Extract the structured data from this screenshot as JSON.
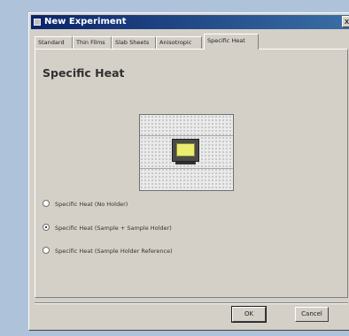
{
  "window": {
    "title": "New Experiment",
    "close_glyph": "x"
  },
  "tabs": [
    {
      "label": "Standard"
    },
    {
      "label": "Thin Films"
    },
    {
      "label": "Slab Sheets"
    },
    {
      "label": "Anisotropic"
    },
    {
      "label": "Specific Heat"
    }
  ],
  "panel": {
    "heading": "Specific Heat",
    "options": [
      {
        "label": "Specific Heat (No Holder)",
        "selected": false
      },
      {
        "label": "Specific Heat (Sample + Sample Holder)",
        "selected": true
      },
      {
        "label": "Specific Heat (Sample Holder Reference)",
        "selected": false
      }
    ]
  },
  "buttons": {
    "ok": "OK",
    "cancel": "Cancel"
  },
  "colors": {
    "desktop": "#aec2da",
    "titlebar": "#0a246a",
    "dialog_face": "#d4d0c8",
    "sample": "#ecec70",
    "holder": "#4a4a4a"
  }
}
